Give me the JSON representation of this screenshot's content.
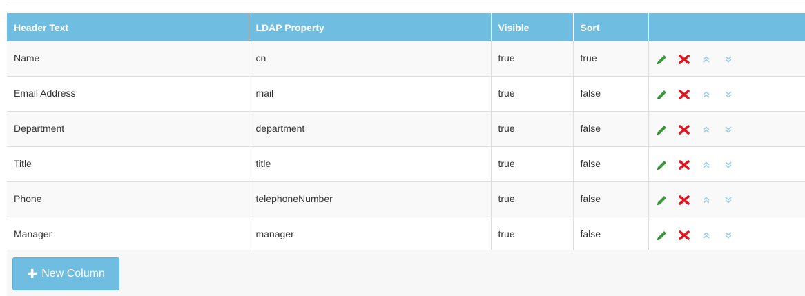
{
  "table": {
    "headers": [
      "Header Text",
      "LDAP Property",
      "Visible",
      "Sort",
      ""
    ],
    "rows": [
      {
        "header_text": "Name",
        "ldap_property": "cn",
        "visible": "true",
        "sort": "true"
      },
      {
        "header_text": "Email Address",
        "ldap_property": "mail",
        "visible": "true",
        "sort": "false"
      },
      {
        "header_text": "Department",
        "ldap_property": "department",
        "visible": "true",
        "sort": "false"
      },
      {
        "header_text": "Title",
        "ldap_property": "title",
        "visible": "true",
        "sort": "false"
      },
      {
        "header_text": "Phone",
        "ldap_property": "telephoneNumber",
        "visible": "true",
        "sort": "false"
      },
      {
        "header_text": "Manager",
        "ldap_property": "manager",
        "visible": "true",
        "sort": "false"
      }
    ],
    "row_actions": [
      "edit-icon",
      "delete-icon",
      "move-up-icon",
      "move-down-icon"
    ]
  },
  "footer": {
    "new_column_label": "New Column",
    "new_column_icon": "plus-icon"
  },
  "colors": {
    "header_bg": "#6fbde0",
    "edit": "#3a9a3a",
    "delete": "#e0141e",
    "move": "#9fcde6"
  }
}
